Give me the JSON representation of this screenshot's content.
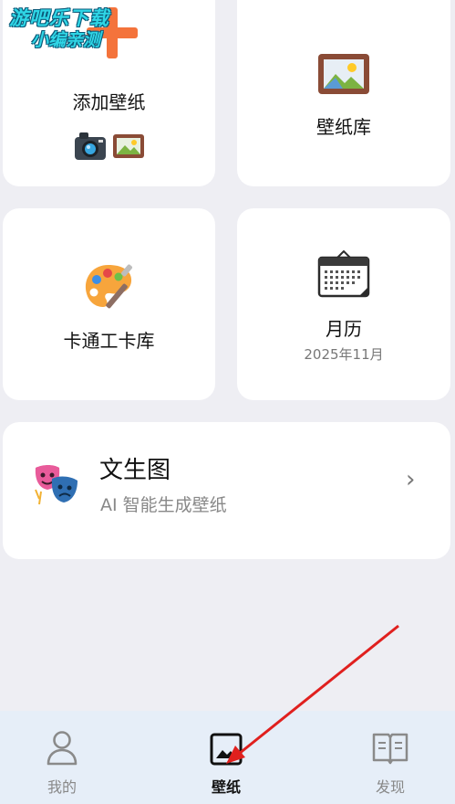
{
  "watermark": {
    "line1": "游吧乐下载",
    "line2": "小编亲测"
  },
  "cards": {
    "add_wallpaper": {
      "label": "添加壁纸",
      "icon": "plus-icon"
    },
    "wallpaper_library": {
      "label": "壁纸库",
      "icon": "framed-picture-icon"
    },
    "cartoon_library": {
      "label": "卡通工卡库",
      "icon": "artist-palette-icon"
    },
    "calendar": {
      "label": "月历",
      "sub": "2025年11月",
      "icon": "calendar-icon"
    },
    "text_to_image": {
      "title": "文生图",
      "subtitle": "AI 智能生成壁纸",
      "icon": "performing-arts-icon",
      "chevron": "›"
    }
  },
  "bottom_nav": {
    "items": [
      {
        "label": "我的",
        "icon": "person-icon",
        "active": false
      },
      {
        "label": "壁纸",
        "icon": "wallpaper-icon",
        "active": true
      },
      {
        "label": "发现",
        "icon": "book-icon",
        "active": false
      }
    ]
  },
  "colors": {
    "accent_orange": "#f4733b",
    "arrow_red": "#e0201e",
    "nav_bg": "#e6eef8",
    "page_bg": "#eeeef3"
  }
}
